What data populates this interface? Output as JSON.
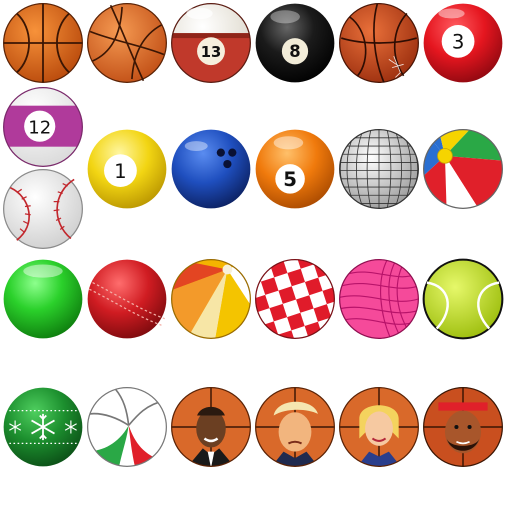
{
  "sheet": {
    "title": "",
    "balls": [
      {
        "kind": "basketball-icon"
      },
      {
        "kind": "basketball-icon"
      },
      {
        "kind": "billiard-ball-icon",
        "number": "13",
        "color": "#c0392b",
        "stripe": true
      },
      {
        "kind": "billiard-ball-icon",
        "number": "8",
        "color": "#111111",
        "stripe": false
      },
      {
        "kind": "basketball-icon"
      },
      {
        "kind": "billiard-ball-icon",
        "number": "3",
        "color": "#e5161f",
        "stripe": false
      },
      {
        "kind": "billiard-ball-icon",
        "number": "12",
        "color": "#b03a9b",
        "stripe": true
      },
      {
        "kind": "baseball-icon"
      },
      {
        "kind": "billiard-ball-icon",
        "number": "1",
        "color": "#f2d513",
        "stripe": false
      },
      {
        "kind": "bowling-ball-icon",
        "color": "#1f4fbf"
      },
      {
        "kind": "billiard-ball-icon",
        "number": "5",
        "color": "#f07a0c",
        "stripe": false
      },
      {
        "kind": "disco-ball-icon"
      },
      {
        "kind": "beach-ball-icon"
      },
      {
        "kind": "green-ball-icon",
        "color": "#2bd12b"
      },
      {
        "kind": "cricket-ball-icon",
        "color": "#d01c22"
      },
      {
        "kind": "beach-ball-icon"
      },
      {
        "kind": "checkered-ball-icon"
      },
      {
        "kind": "yarn-ball-icon",
        "color": "#f54a9a"
      },
      {
        "kind": "tennis-ball-icon",
        "color": "#c3e41f"
      },
      {
        "kind": "christmas-ornament-icon",
        "color": "#1c8f2e"
      },
      {
        "kind": "volleyball-icon"
      },
      {
        "kind": "basketball-portrait-icon"
      },
      {
        "kind": "basketball-portrait-icon"
      },
      {
        "kind": "basketball-portrait-icon"
      },
      {
        "kind": "basketball-portrait-icon"
      }
    ]
  }
}
